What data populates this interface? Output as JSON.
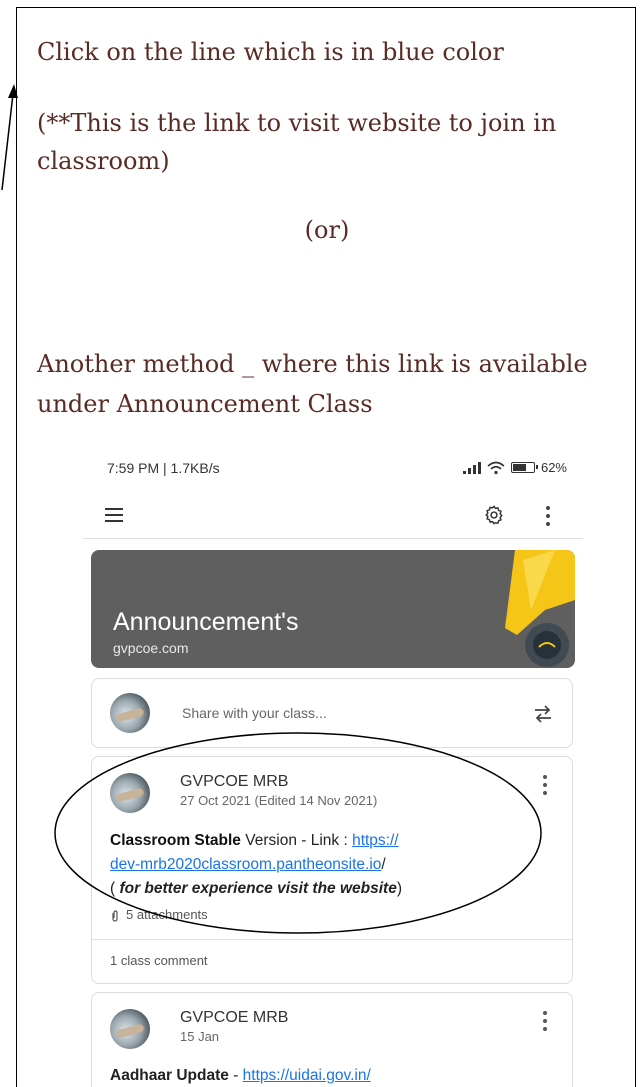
{
  "instructions": {
    "line1": "Click on the line which is in blue color",
    "line2": "(**This is the link to visit website to join in classroom)",
    "line3": "(or)",
    "line4": "Another method _ where this link is available under Announcement Class"
  },
  "phone": {
    "status": {
      "time": "7:59 PM | 1.7KB/s",
      "battery": "62%"
    },
    "icons": {
      "menu": "menu-icon",
      "settings": "gear-icon",
      "more": "more-vert-icon"
    },
    "banner": {
      "title": "Announcement's",
      "subtitle": "gvpcoe.com",
      "bg": "#5f5f5f",
      "accent": "#f5c518"
    },
    "share": {
      "placeholder": "Share with your class..."
    },
    "posts": [
      {
        "author": "GVPCOE MRB",
        "date": "27 Oct 2021 (Edited 14 Nov 2021)",
        "text_prefix": "Classroom Stable",
        "text_mid": " Version - Link : ",
        "link1": "https://",
        "link2": "dev-mrb2020classroom.pantheonsite.io",
        "link_suffix": "/",
        "note_open": "( ",
        "note": "for better experience visit the website",
        "note_close": ")",
        "attachments": "5 attachments",
        "comments": "1 class comment"
      },
      {
        "author": "GVPCOE MRB",
        "date": "15 Jan",
        "text_prefix": "Aadhaar Update",
        "text_mid": " - ",
        "link": "https://uidai.gov.in/"
      }
    ],
    "link_color": "#1a73e8"
  }
}
